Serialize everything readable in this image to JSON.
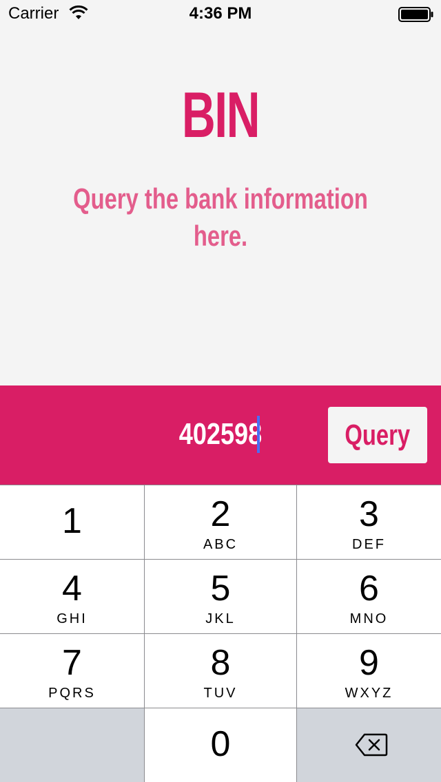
{
  "status_bar": {
    "carrier": "Carrier",
    "time": "4:36 PM",
    "wifi_icon": "wifi-icon",
    "battery_icon": "battery-icon"
  },
  "header": {
    "title": "BIN",
    "subtitle": "Query the bank information here."
  },
  "query_bar": {
    "input_value": "402598",
    "button_label": "Query"
  },
  "keypad": {
    "keys": [
      {
        "digit": "1",
        "letters": ""
      },
      {
        "digit": "2",
        "letters": "ABC"
      },
      {
        "digit": "3",
        "letters": "DEF"
      },
      {
        "digit": "4",
        "letters": "GHI"
      },
      {
        "digit": "5",
        "letters": "JKL"
      },
      {
        "digit": "6",
        "letters": "MNO"
      },
      {
        "digit": "7",
        "letters": "PQRS"
      },
      {
        "digit": "8",
        "letters": "TUV"
      },
      {
        "digit": "9",
        "letters": "WXYZ"
      },
      {
        "digit": "0",
        "letters": ""
      }
    ],
    "delete_icon": "backspace-icon"
  },
  "colors": {
    "accent": "#d91e65",
    "subtitle": "#e35d8c",
    "background": "#f4f4f4",
    "caret": "#4a6ef5",
    "keypad_dark_key": "#d1d5db"
  }
}
